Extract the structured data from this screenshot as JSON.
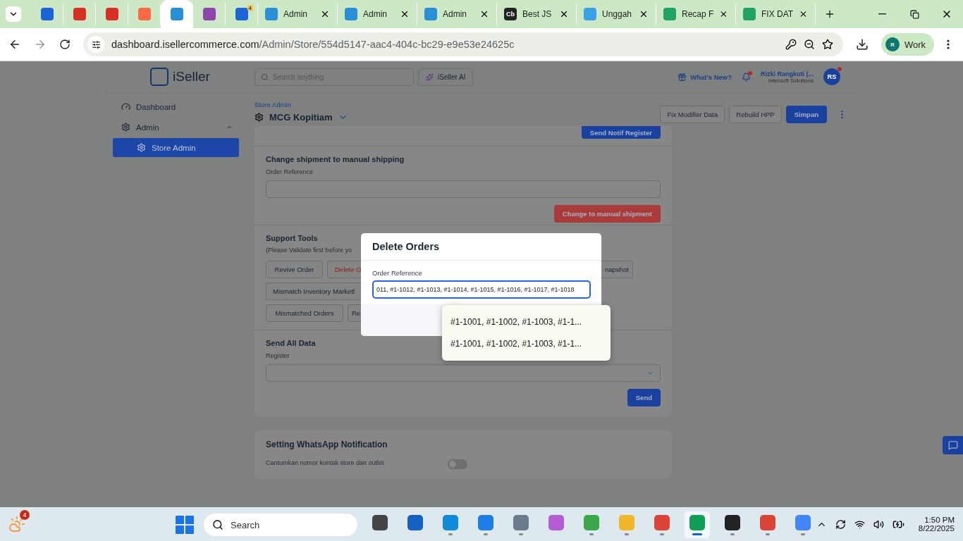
{
  "browser": {
    "tabs": [
      {
        "kind": "icon",
        "color": "#1d63d8",
        "selected": false
      },
      {
        "kind": "icon",
        "color": "#d93025",
        "selected": false
      },
      {
        "kind": "icon",
        "color": "#d93025",
        "selected": false
      },
      {
        "kind": "icon",
        "color": "#ff6a45",
        "selected": false
      },
      {
        "kind": "icon",
        "color": "#2a8fd6",
        "selected": true
      },
      {
        "kind": "icon",
        "color": "#8e44ad",
        "selected": false
      },
      {
        "kind": "icon",
        "color": "#1d63d8",
        "badge": "4",
        "selected": false
      },
      {
        "kind": "labeled",
        "color": "#2a8fd6",
        "label": "Admin",
        "selected": false
      },
      {
        "kind": "labeled",
        "color": "#2a8fd6",
        "label": "Admin",
        "selected": false
      },
      {
        "kind": "labeled",
        "color": "#2a8fd6",
        "label": "Admin",
        "selected": false
      },
      {
        "kind": "labeled",
        "color": "#222222",
        "icon_text": "Cb",
        "label": "Best JS",
        "selected": false
      },
      {
        "kind": "labeled",
        "color": "#3aa0e8",
        "label": "Unggah",
        "selected": false
      },
      {
        "kind": "labeled",
        "color": "#1fa463",
        "label": "Recap F",
        "selected": false
      },
      {
        "kind": "labeled",
        "color": "#1fa463",
        "label": "FIX DAT",
        "selected": false
      }
    ],
    "address": {
      "host": "dashboard.isellercommerce.com",
      "path": "/Admin/Store/554d5147-aac4-404c-bc29-e9e53e24625c"
    },
    "profile": {
      "initial": "R",
      "label": "Work"
    }
  },
  "header": {
    "brand": "iSeller",
    "search": {
      "placeholder": "Search anything"
    },
    "ai_button": "iSeller AI",
    "whats_new": "What's New?",
    "user": {
      "name": "Rizki Rangkuti (...",
      "company": "Intersoft Solutions",
      "initials": "RS"
    }
  },
  "sidebar": {
    "items": [
      {
        "label": "Dashboard",
        "kind": "dashboard",
        "selected": false
      },
      {
        "label": "Admin",
        "kind": "settings",
        "expanded": true,
        "selected": false,
        "children": [
          {
            "label": "Store Admin",
            "kind": "settings",
            "selected": true
          }
        ]
      }
    ]
  },
  "page": {
    "breadcrumb": "Store Admin",
    "title": "MCG Kopitiam",
    "actions": [
      "Fix Modifier Data",
      "Rebuild HPP",
      "Simpan"
    ]
  },
  "card": {
    "top_button": "Send Notif Register",
    "shipment": {
      "title": "Change shipment to manual shipping",
      "label": "Order Reference",
      "button": "Change to manual shipment"
    },
    "support": {
      "title": "Support Tools",
      "note": "(Please Validate first before yo",
      "rows": [
        [
          "Revive Order",
          "Delete O",
          "napshot"
        ],
        [
          "Mismatch Inventory Marketl"
        ],
        [
          "Mismatched Orders",
          "Re"
        ]
      ]
    },
    "send_all": {
      "title": "Send All Data",
      "label": "Register",
      "button": "Send"
    }
  },
  "whatsapp": {
    "title": "Setting WhatsApp Notification",
    "label": "Cantumkan nomor kontak store dan outlet",
    "on": false
  },
  "modal": {
    "title": "Delete Orders",
    "label": "Order Reference",
    "value": "011, #1-1012, #1-1013, #1-1014, #1-1015, #1-1016, #1-1017, #1-1018"
  },
  "suggestions": [
    "#1-1001, #1-1002, #1-1003, #1-1...",
    "#1-1001, #1-1002, #1-1003, #1-1..."
  ],
  "taskbar": {
    "weather_badge": "4",
    "search": "Search",
    "apps": [
      {
        "color": "#444444",
        "running": false,
        "selected": false
      },
      {
        "color": "#1560c0",
        "running": false,
        "selected": false
      },
      {
        "color": "#0f8ad8",
        "running": true,
        "selected": false
      },
      {
        "color": "#1e7ce6",
        "running": true,
        "selected": false
      },
      {
        "color": "#6b7a8c",
        "running": true,
        "selected": false
      },
      {
        "color": "#b45cd6",
        "running": false,
        "selected": false
      },
      {
        "color": "#3aa84a",
        "running": true,
        "selected": false
      },
      {
        "color": "#f2b62b",
        "running": true,
        "selected": false
      },
      {
        "color": "#db4437",
        "running": true,
        "selected": false
      },
      {
        "color": "#0f9d58",
        "running": true,
        "selected": true
      },
      {
        "color": "#222222",
        "running": true,
        "selected": false
      },
      {
        "color": "#db4437",
        "running": true,
        "selected": false
      },
      {
        "color": "#4285f4",
        "running": true,
        "selected": false
      }
    ],
    "time": "1:50 PM",
    "date": "8/22/2025"
  }
}
